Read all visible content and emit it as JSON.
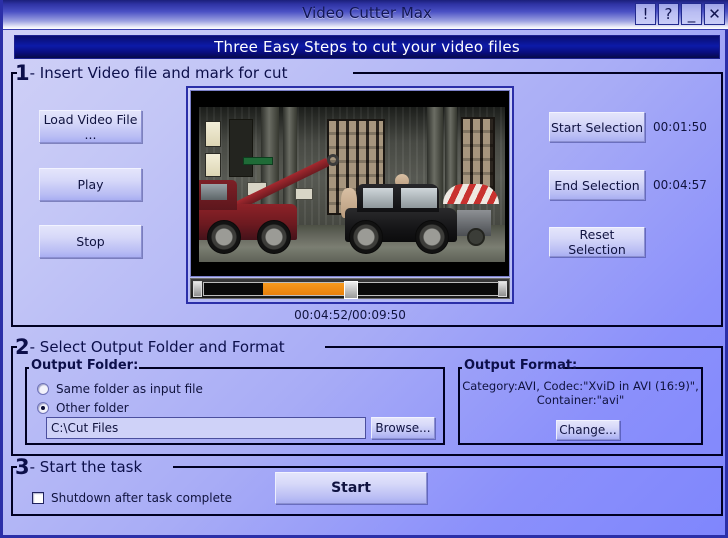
{
  "window": {
    "title": "Video Cutter Max",
    "buttons": [
      {
        "name": "info-button",
        "label": "!"
      },
      {
        "name": "help-button",
        "label": "?"
      },
      {
        "name": "minimize-button",
        "label": "_"
      },
      {
        "name": "close-button",
        "label": "✕"
      }
    ]
  },
  "banner": {
    "text": "Three Easy Steps to cut your video files"
  },
  "step1": {
    "number": "1",
    "legend": "- Insert Video file and mark for cut",
    "load_button": "Load Video File ...",
    "play_button": "Play",
    "stop_button": "Stop",
    "start_selection_button": "Start Selection",
    "end_selection_button": "End Selection",
    "reset_selection_button": "Reset Selection",
    "start_selection_time": "00:01:50",
    "end_selection_time": "00:04:57",
    "video_time": "00:04:52/00:09:50",
    "seek": {
      "position_percent": 50,
      "selection_start_percent": 20,
      "selection_end_percent": 49
    }
  },
  "step2": {
    "number": "2",
    "legend": "- Select Output Folder and Format",
    "output_folder": {
      "legend": "Output Folder:",
      "option_same_label": "Same folder as input file",
      "option_same_selected": false,
      "option_other_label": "Other folder",
      "option_other_selected": true,
      "path_value": "C:\\Cut Files",
      "browse_button": "Browse..."
    },
    "output_format": {
      "legend": "Output Format:",
      "description_line1": "Category:AVI, Codec:\"XviD in AVI (16:9)\",",
      "description_line2": "Container:\"avi\"",
      "change_button": "Change..."
    }
  },
  "step3": {
    "number": "3",
    "legend": "- Start the task",
    "shutdown_label": "Shutdown after task complete",
    "shutdown_checked": false,
    "start_button": "Start"
  },
  "colors": {
    "accent_orange": "#f79a1e",
    "banner_blue": "#0c1aa8",
    "text_navy": "#10133e",
    "background": "#a8acf6"
  }
}
